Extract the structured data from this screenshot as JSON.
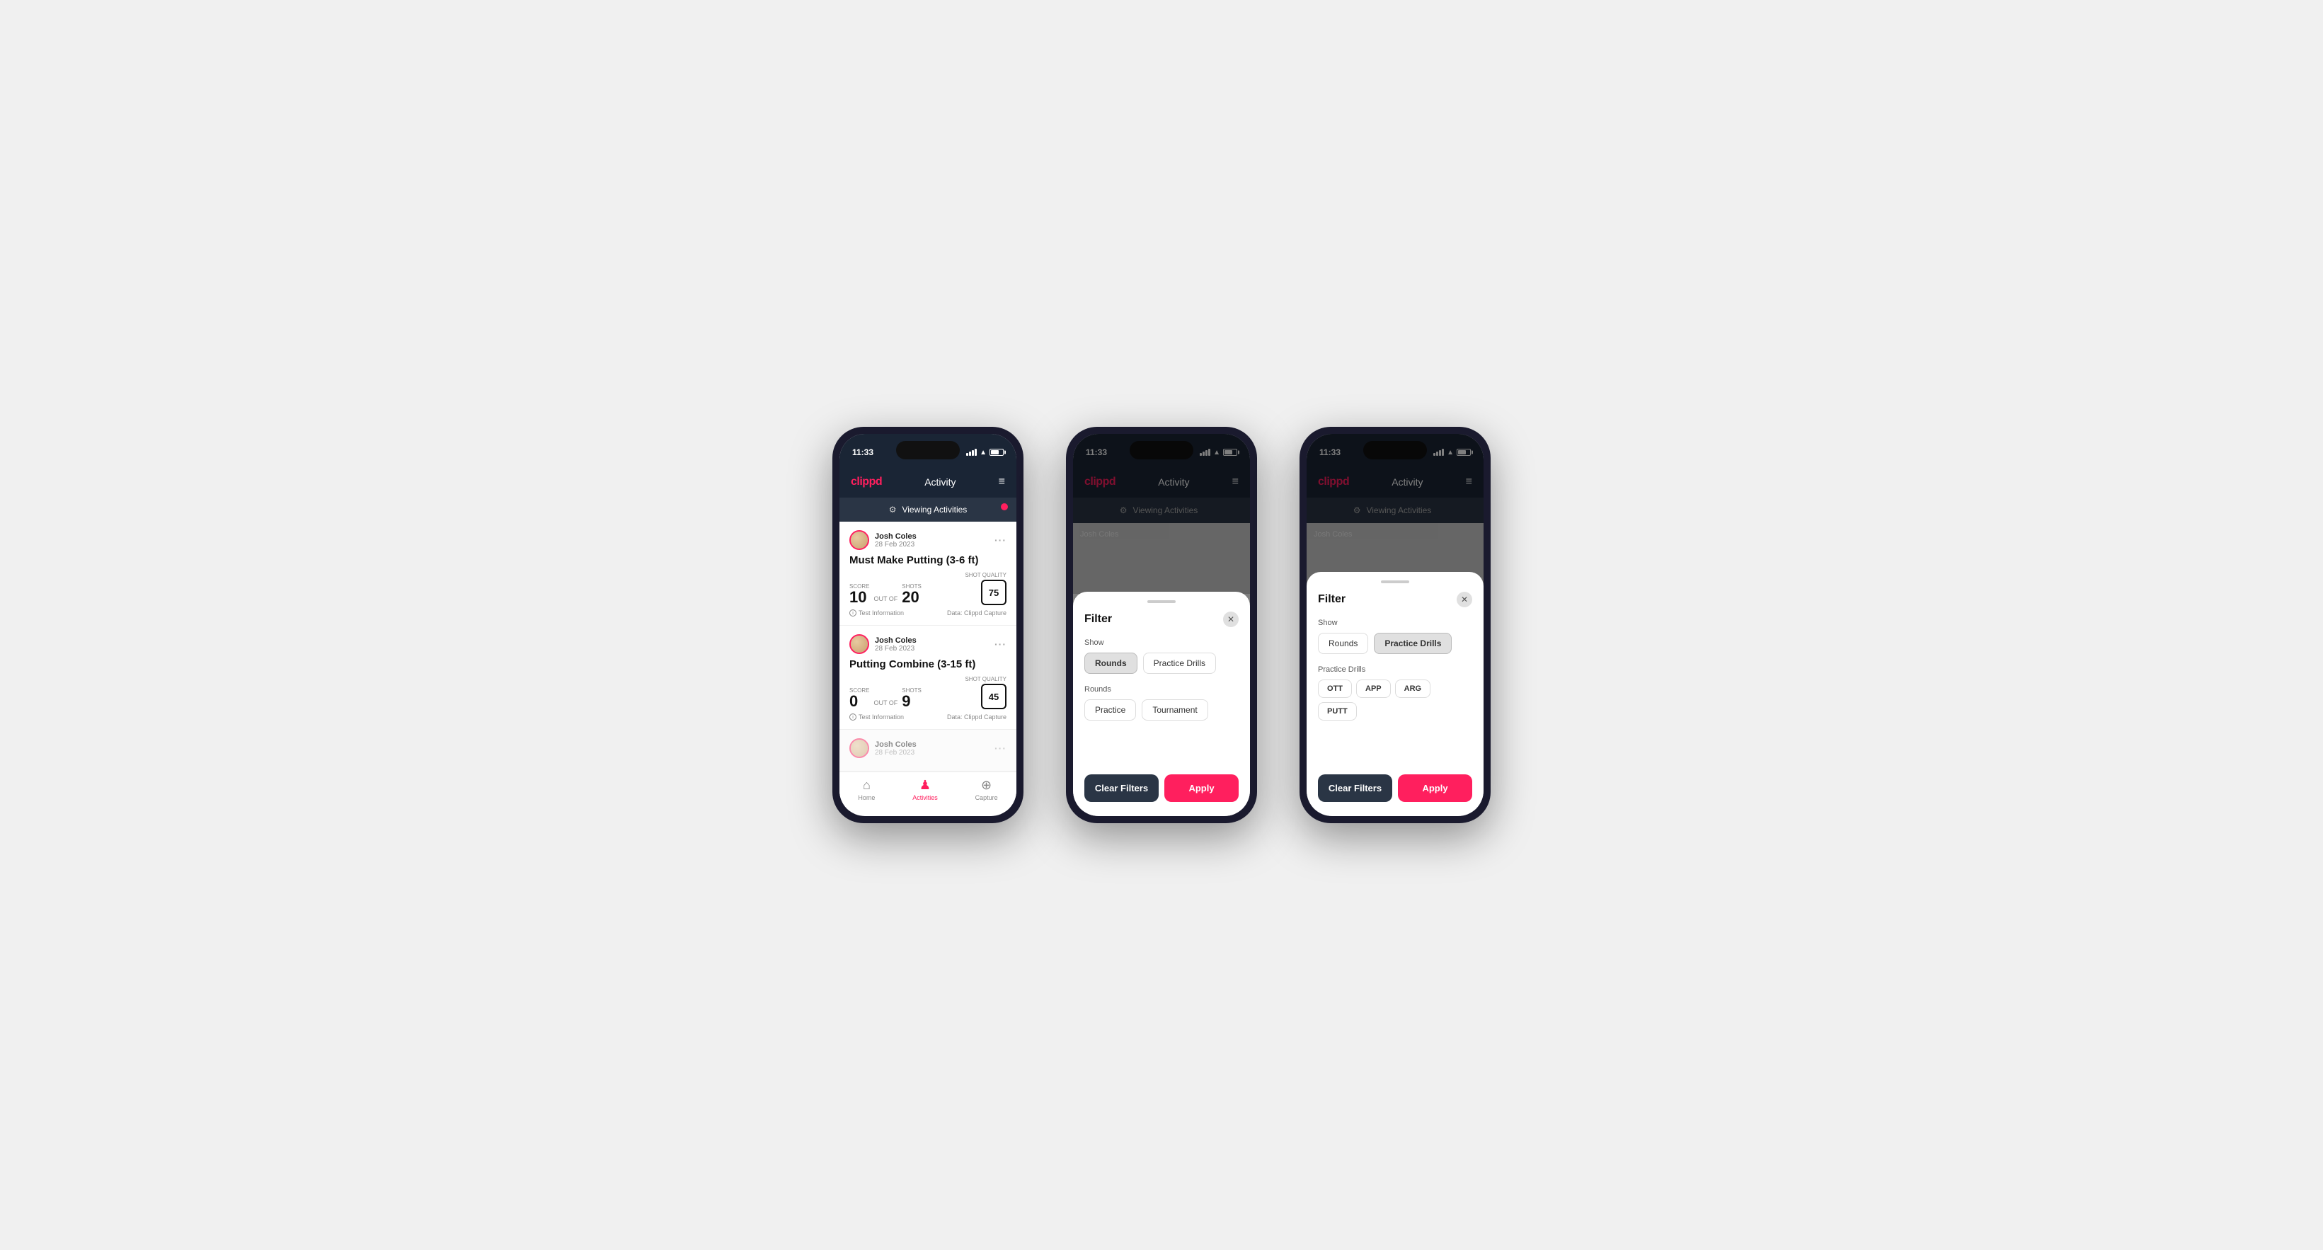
{
  "phones": [
    {
      "id": "phone1",
      "status_bar": {
        "time": "11:33",
        "battery_level": "73"
      },
      "nav": {
        "logo": "clippd",
        "title": "Activity",
        "menu_icon": "≡"
      },
      "viewing_bar": {
        "text": "Viewing Activities",
        "has_dot": true
      },
      "activities": [
        {
          "user_name": "Josh Coles",
          "user_date": "28 Feb 2023",
          "title": "Must Make Putting (3-6 ft)",
          "score": "10",
          "out_of_label": "OUT OF",
          "shots": "20",
          "shot_quality_label": "Shot Quality",
          "shot_quality": "75",
          "score_label": "Score",
          "shots_label": "Shots",
          "footer_left": "Test Information",
          "footer_right": "Data: Clippd Capture"
        },
        {
          "user_name": "Josh Coles",
          "user_date": "28 Feb 2023",
          "title": "Putting Combine (3-15 ft)",
          "score": "0",
          "out_of_label": "OUT OF",
          "shots": "9",
          "shot_quality_label": "Shot Quality",
          "shot_quality": "45",
          "score_label": "Score",
          "shots_label": "Shots",
          "footer_left": "Test Information",
          "footer_right": "Data: Clippd Capture"
        }
      ],
      "bottom_nav": [
        {
          "icon": "🏠",
          "label": "Home",
          "active": false
        },
        {
          "icon": "♟",
          "label": "Activities",
          "active": true
        },
        {
          "icon": "⊕",
          "label": "Capture",
          "active": false
        }
      ]
    },
    {
      "id": "phone2",
      "status_bar": {
        "time": "11:33"
      },
      "nav": {
        "logo": "clippd",
        "title": "Activity",
        "menu_icon": "≡"
      },
      "viewing_bar": {
        "text": "Viewing Activities",
        "has_dot": true
      },
      "filter": {
        "title": "Filter",
        "show_label": "Show",
        "rounds_label": "Rounds",
        "practice_drills_label": "Practice Drills",
        "rounds_section_label": "Rounds",
        "practice_label": "Practice",
        "tournament_label": "Tournament",
        "active_toggle": "rounds",
        "clear_filters_label": "Clear Filters",
        "apply_label": "Apply"
      }
    },
    {
      "id": "phone3",
      "status_bar": {
        "time": "11:33"
      },
      "nav": {
        "logo": "clippd",
        "title": "Activity",
        "menu_icon": "≡"
      },
      "viewing_bar": {
        "text": "Viewing Activities",
        "has_dot": true
      },
      "filter": {
        "title": "Filter",
        "show_label": "Show",
        "rounds_label": "Rounds",
        "practice_drills_label": "Practice Drills",
        "practice_drills_section_label": "Practice Drills",
        "active_toggle": "practice_drills",
        "tags": [
          "OTT",
          "APP",
          "ARG",
          "PUTT"
        ],
        "clear_filters_label": "Clear Filters",
        "apply_label": "Apply"
      }
    }
  ]
}
